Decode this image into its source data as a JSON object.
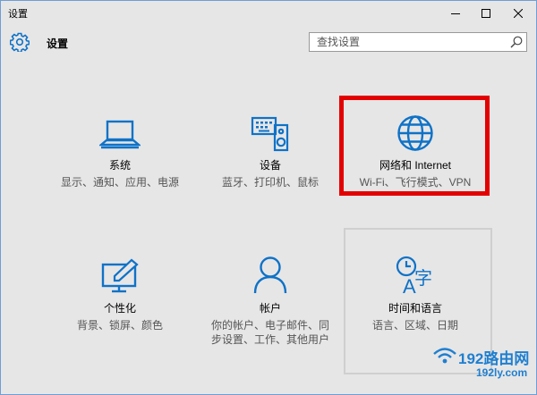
{
  "window": {
    "title": "设置"
  },
  "header": {
    "app_title": "设置",
    "search_placeholder": "查找设置"
  },
  "tiles": [
    {
      "name": "系统",
      "desc": "显示、通知、应用、电源",
      "icon": "laptop-icon"
    },
    {
      "name": "设备",
      "desc": "蓝牙、打印机、鼠标",
      "icon": "devices-icon"
    },
    {
      "name": "网络和 Internet",
      "desc": "Wi-Fi、飞行模式、VPN",
      "icon": "globe-icon"
    },
    {
      "name": "个性化",
      "desc": "背景、锁屏、颜色",
      "icon": "personalization-icon"
    },
    {
      "name": "帐户",
      "desc": "你的帐户、电子邮件、同步设置、工作、其他用户",
      "icon": "person-icon"
    },
    {
      "name": "时间和语言",
      "desc": "语言、区域、日期",
      "icon": "time-language-icon"
    }
  ],
  "watermark": {
    "brand": "192路由网",
    "sub": "192ly.com"
  },
  "colors": {
    "accent": "#0f72c7",
    "highlight": "#e30000"
  }
}
